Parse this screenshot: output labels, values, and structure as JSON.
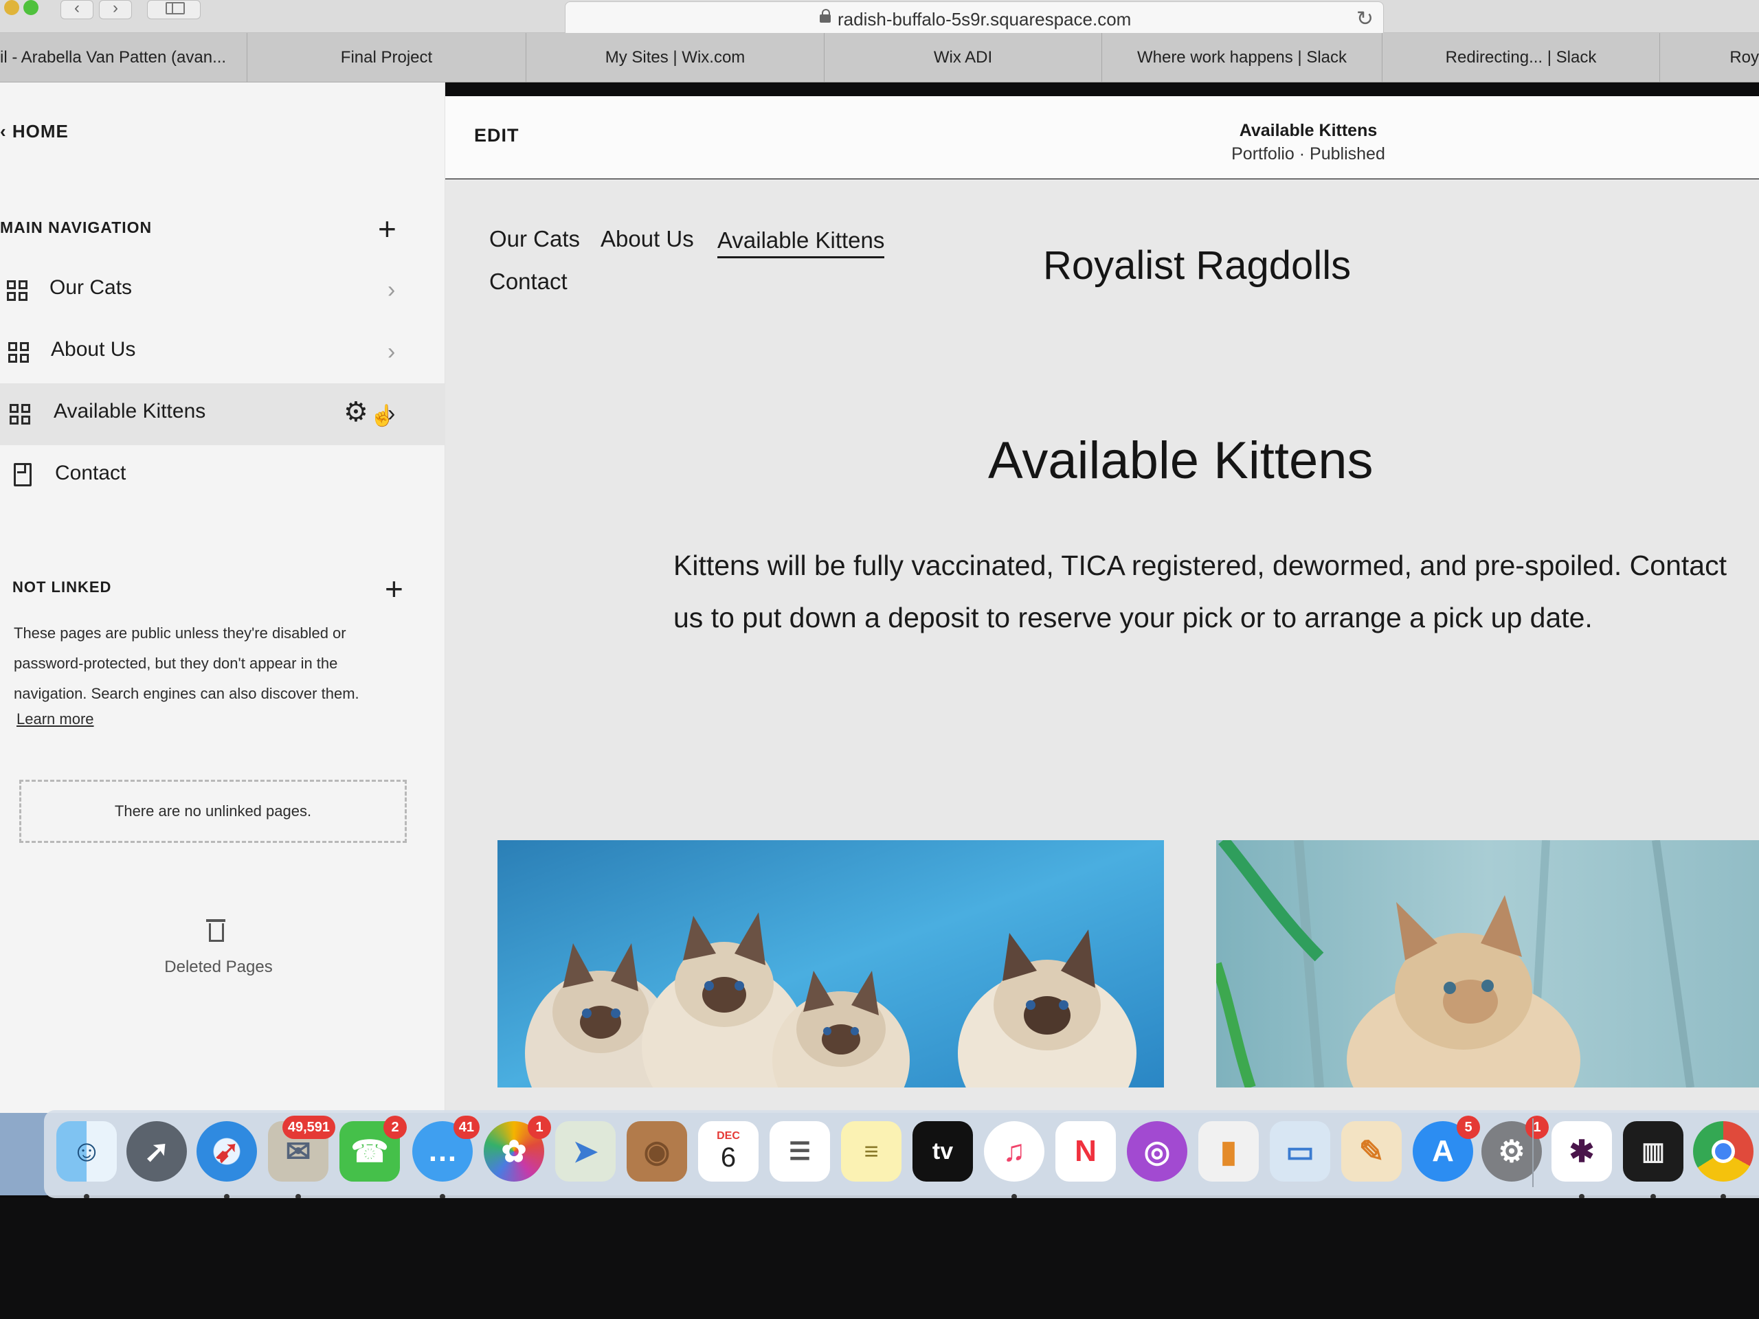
{
  "browser": {
    "url": "radish-buffalo-5s9r.squarespace.com",
    "tabs": [
      "il - Arabella Van Patten (avan...",
      "Final Project",
      "My Sites | Wix.com",
      "Wix ADI",
      "Where work happens | Slack",
      "Redirecting... | Slack",
      "Roy"
    ]
  },
  "sidebar": {
    "home_label": "HOME",
    "main_nav_title": "MAIN NAVIGATION",
    "items": [
      {
        "label": "Our Cats",
        "icon": "grid-icon"
      },
      {
        "label": "About Us",
        "icon": "grid-icon"
      },
      {
        "label": "Available Kittens",
        "icon": "grid-icon",
        "active": true
      },
      {
        "label": "Contact",
        "icon": "page-icon"
      }
    ],
    "not_linked_title": "NOT LINKED",
    "not_linked_description": "These pages are public unless they're disabled or password-protected, but they don't appear in the navigation. Search engines can also discover them.",
    "learn_more": "Learn more",
    "no_unlinked": "There are no unlinked pages.",
    "deleted_pages": "Deleted Pages"
  },
  "editor": {
    "edit_label": "EDIT",
    "page_name": "Available Kittens",
    "page_meta": "Portfolio · Published"
  },
  "site": {
    "nav": [
      "Our Cats",
      "About Us",
      "Available Kittens",
      "Contact"
    ],
    "current_nav": "Available Kittens",
    "title": "Royalist Ragdolls",
    "heading": "Available Kittens",
    "body": "Kittens will be fully vaccinated, TICA registered, dewormed, and pre-spoiled. Contact us to put down a deposit to reserve your pick or to arrange a pick up date."
  },
  "dock": {
    "badges": {
      "mail": "49,591",
      "facetime": "2",
      "messages": "41",
      "photos": "1",
      "app_store": "5",
      "system_preferences": "1"
    },
    "calendar_month": "DEC",
    "calendar_day": "6",
    "tv_label": "tv"
  },
  "colors": {
    "sidebar_bg": "#f4f4f4",
    "site_bg": "#e8e8e8",
    "badge": "#e53935"
  }
}
